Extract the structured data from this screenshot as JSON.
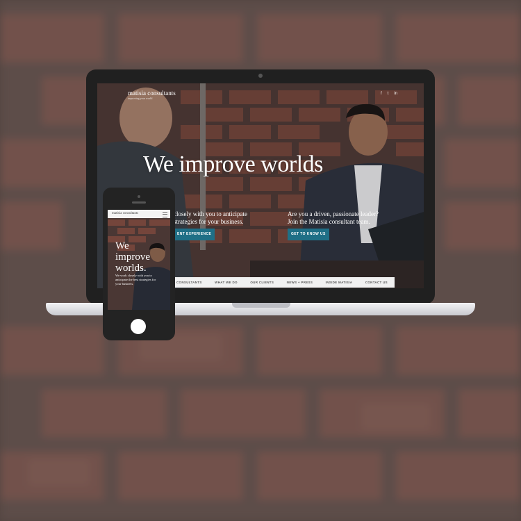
{
  "site": {
    "logo": "matisia consultants",
    "tagline": "improving your world",
    "social": [
      "f",
      "t",
      "in"
    ],
    "hero_title": "We improve worlds",
    "left_copy": "closely with you to anticipate strategies for your business.",
    "left_cta": "ENT EXPERIENCE",
    "right_copy": "Are you a driven, passionate leader? Join the Matisia consultant team.",
    "right_cta": "GET TO KNOW US",
    "nav": [
      "CONSULTANTS",
      "WHAT WE DO",
      "OUR CLIENTS",
      "NEWS + PRESS",
      "INSIDE MATISIA",
      "CONTACT US"
    ]
  },
  "mobile": {
    "logo": "matisia consultants",
    "hero_title": "We improve worlds.",
    "sub": "We work closely with you to anticipate the best strategies for your business."
  },
  "colors": {
    "accent": "#1f6f86",
    "device": "#202020",
    "nav_bg": "#f1f1f1"
  },
  "icons": {
    "social": [
      "facebook-icon",
      "twitter-icon",
      "linkedin-icon"
    ],
    "menu": "hamburger-menu-icon"
  }
}
